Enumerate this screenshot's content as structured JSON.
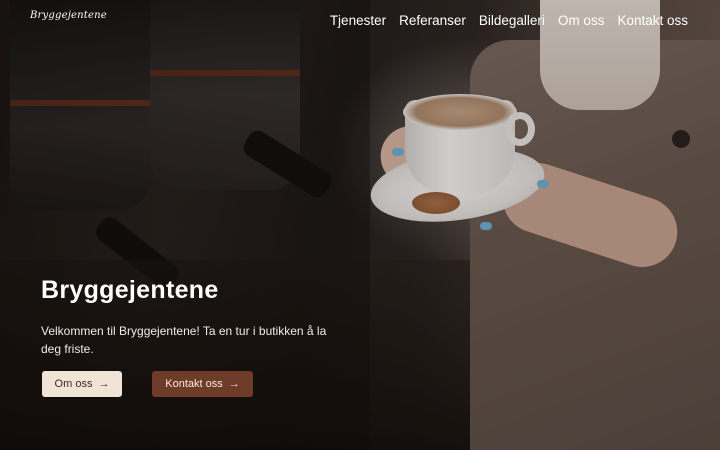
{
  "header": {
    "logo_text": "Bryggejentene",
    "nav": [
      "Tjenester",
      "Referanser",
      "Bildegalleri",
      "Om oss",
      "Kontakt oss"
    ]
  },
  "hero": {
    "title": "Bryggejentene",
    "text": "Velkommen til Bryggejentene! Ta en tur i butikken å la deg friste.",
    "buttons": {
      "om_oss": "Om oss",
      "kontakt_oss": "Kontakt oss",
      "arrow_icon": "→"
    }
  },
  "colors": {
    "btn_light": "#f1e3d6",
    "btn_dark": "#6e3b29"
  }
}
